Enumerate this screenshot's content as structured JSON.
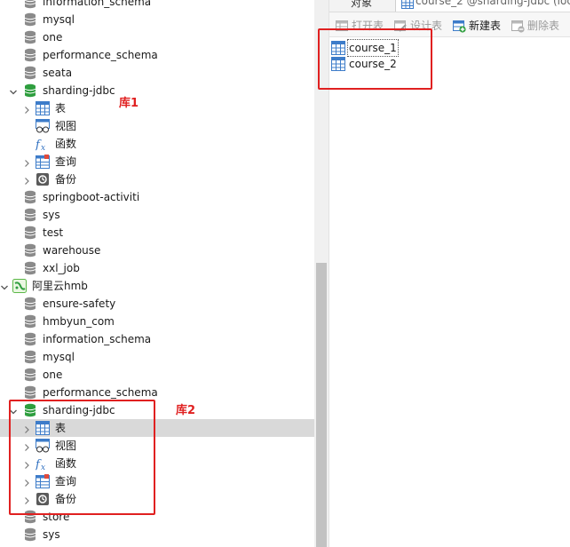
{
  "tree": {
    "rows": [
      {
        "label": "information_schema",
        "type": "db",
        "indent": 1,
        "open": false
      },
      {
        "label": "mysql",
        "type": "db",
        "indent": 1,
        "open": false
      },
      {
        "label": "one",
        "type": "db",
        "indent": 1,
        "open": false
      },
      {
        "label": "performance_schema",
        "type": "db",
        "indent": 1,
        "open": false
      },
      {
        "label": "seata",
        "type": "db",
        "indent": 1,
        "open": false
      },
      {
        "label": "sharding-jdbc",
        "type": "db-open",
        "indent": 1,
        "expander": "down"
      },
      {
        "label": "表",
        "type": "tables",
        "indent": 2,
        "expander": "right"
      },
      {
        "label": "视图",
        "type": "views",
        "indent": 2,
        "expander": "none"
      },
      {
        "label": "函数",
        "type": "functions",
        "indent": 2,
        "expander": "none"
      },
      {
        "label": "查询",
        "type": "queries",
        "indent": 2,
        "expander": "right"
      },
      {
        "label": "备份",
        "type": "backups",
        "indent": 2,
        "expander": "right"
      },
      {
        "label": "springboot-activiti",
        "type": "db",
        "indent": 1
      },
      {
        "label": "sys",
        "type": "db",
        "indent": 1
      },
      {
        "label": "test",
        "type": "db",
        "indent": 1
      },
      {
        "label": "warehouse",
        "type": "db",
        "indent": 1
      },
      {
        "label": "xxl_job",
        "type": "db",
        "indent": 1
      },
      {
        "label": "阿里云hmb",
        "type": "connection",
        "indent": 0,
        "expander": "down"
      },
      {
        "label": "ensure-safety",
        "type": "db",
        "indent": 1
      },
      {
        "label": "hmbyun_com",
        "type": "db",
        "indent": 1
      },
      {
        "label": "information_schema",
        "type": "db",
        "indent": 1
      },
      {
        "label": "mysql",
        "type": "db",
        "indent": 1
      },
      {
        "label": "one",
        "type": "db",
        "indent": 1
      },
      {
        "label": "performance_schema",
        "type": "db",
        "indent": 1
      },
      {
        "label": "sharding-jdbc",
        "type": "db-open",
        "indent": 1,
        "expander": "down"
      },
      {
        "label": "表",
        "type": "tables",
        "indent": 2,
        "expander": "right",
        "selected": true
      },
      {
        "label": "视图",
        "type": "views",
        "indent": 2,
        "expander": "right"
      },
      {
        "label": "函数",
        "type": "functions",
        "indent": 2,
        "expander": "right"
      },
      {
        "label": "查询",
        "type": "queries",
        "indent": 2,
        "expander": "right"
      },
      {
        "label": "备份",
        "type": "backups",
        "indent": 2,
        "expander": "right"
      },
      {
        "label": "store",
        "type": "db",
        "indent": 1
      },
      {
        "label": "sys",
        "type": "db",
        "indent": 1
      }
    ]
  },
  "tabs": {
    "objects_label": "对象",
    "doc_label": "course_2 @sharding-jdbc (loc"
  },
  "toolbar": {
    "open_table": "打开表",
    "design_table": "设计表",
    "new_table": "新建表",
    "delete_table": "删除表"
  },
  "objects": [
    {
      "label": "course_1",
      "focused": true
    },
    {
      "label": "course_2",
      "focused": false
    }
  ],
  "annotations": {
    "label1": "库1",
    "label2": "库2"
  },
  "colors": {
    "annotation": "#e02020",
    "db_gray": "#8a8a8a",
    "db_green": "#2e9e3e",
    "table_blue": "#3d7cc9",
    "selection": "#d9d9d9"
  }
}
